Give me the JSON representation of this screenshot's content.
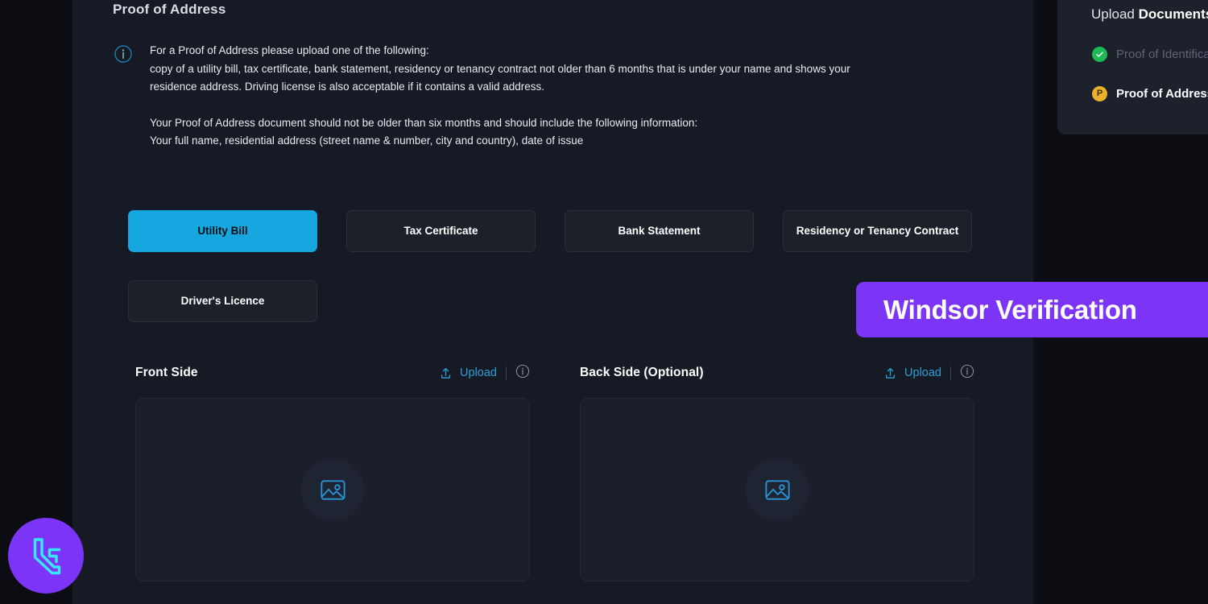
{
  "section": {
    "title": "Proof of Address",
    "info_icon": "info-circle-icon",
    "info_paragraph_1_line_1": "For a Proof of Address please upload one of the following:",
    "info_paragraph_1_line_2": "copy of a utility bill, tax certificate, bank statement, residency or tenancy contract not older than 6 months that is under your name and shows your",
    "info_paragraph_1_line_3": "residence address. Driving license is also acceptable if it contains a valid address.",
    "info_paragraph_2_line_1": "Your Proof of Address document should not be older than six months and should include the following information:",
    "info_paragraph_2_line_2": "Your full name, residential address (street name & number, city and country), date of issue"
  },
  "doc_types": [
    {
      "label": "Utility Bill",
      "selected": true
    },
    {
      "label": "Tax Certificate",
      "selected": false
    },
    {
      "label": "Bank Statement",
      "selected": false
    },
    {
      "label": "Residency or Tenancy Contract",
      "selected": false
    },
    {
      "label": "Driver's Licence",
      "selected": false
    }
  ],
  "uploads": {
    "front": {
      "label": "Front Side",
      "upload_label": "Upload",
      "upload_icon": "upload-arrow-icon",
      "info_icon": "info-circle-icon",
      "placeholder_icon": "image-placeholder-icon"
    },
    "back": {
      "label": "Back Side (Optional)",
      "upload_label": "Upload",
      "upload_icon": "upload-arrow-icon",
      "info_icon": "info-circle-icon",
      "placeholder_icon": "image-placeholder-icon"
    }
  },
  "side_card": {
    "title_prefix": "Upload ",
    "title_strong": "Documents",
    "steps": [
      {
        "label": "Proof of Identification",
        "state": "completed",
        "icon": "check-circle-icon"
      },
      {
        "label": "Proof of Address",
        "state": "current",
        "icon": "pending-circle-icon"
      }
    ]
  },
  "banner": {
    "text": "Windsor Verification",
    "color": "#7c34f7"
  },
  "brand": {
    "logo_icon": "windsor-logo-icon",
    "circle_color": "#7c34f7",
    "mark_color": "#35e8ff"
  },
  "theme": {
    "page_background": "#0c0e14",
    "panel_background": "#161a24",
    "accent_blue": "#16a6e0",
    "link_blue": "#2f9fd6",
    "accent_purple": "#7c34f7",
    "status_done": "#1db954",
    "status_current": "#eab12c"
  }
}
